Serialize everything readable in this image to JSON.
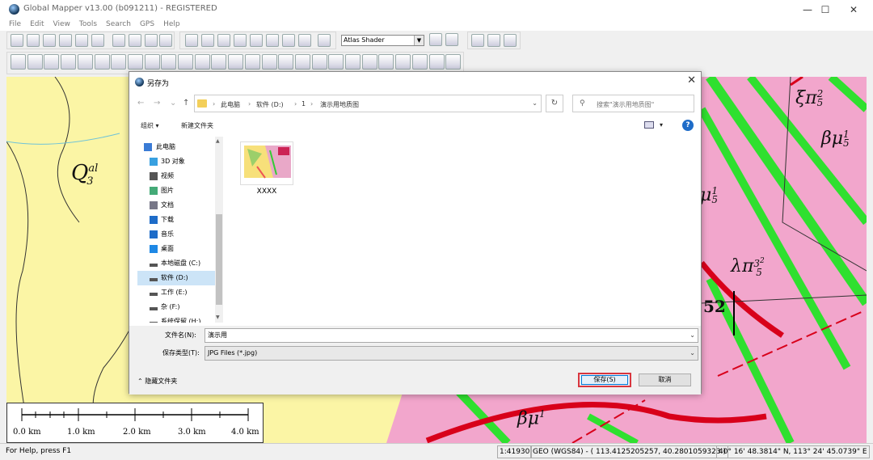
{
  "app": {
    "title": "Global Mapper v13.00 (b091211) - REGISTERED",
    "window_controls": {
      "minimize": "—",
      "maximize": "☐",
      "close": "✕"
    }
  },
  "menu": [
    "File",
    "Edit",
    "View",
    "Tools",
    "Search",
    "GPS",
    "Help"
  ],
  "toolbar": {
    "shader_select": "Atlas Shader"
  },
  "map": {
    "labels": {
      "q3_base": "Q",
      "q3_sup": "al",
      "q3_sub": "3",
      "xi_pi": "ξπ",
      "xi_pi_sup": "2",
      "xi_pi_sub": "5",
      "beta_mu": "βμ",
      "beta_mu_sup": "1",
      "beta_mu_sub": "5",
      "mu_right": "μ",
      "mu_right_sup": "1",
      "mu_right_sub": "5",
      "lambda_pi": "λπ",
      "lambda_pi_sup": "3",
      "lambda_pi_sup2": "2",
      "lambda_pi_sub": "5",
      "number_52": "52",
      "beta_mu_bottom": "βμ",
      "beta_mu_bottom_sup": "1"
    },
    "scale_bar": [
      "0.0 km",
      "1.0 km",
      "2.0 km",
      "3.0 km",
      "4.0 km"
    ]
  },
  "status_bar": {
    "help": "For Help, press F1",
    "scale": "1:41930",
    "coords": "GEO (WGS84) - ( 113.4125205257, 40.2801059323 )",
    "dms": "40° 16' 48.3814\" N, 113° 24' 45.0739\" E"
  },
  "dialog": {
    "title": "另存为",
    "close": "✕",
    "breadcrumb": [
      "此电脑",
      "软件 (D:)",
      "1",
      "演示用地质图"
    ],
    "search_placeholder": "搜索\"演示用地质图\"",
    "organize": "组织 ▾",
    "new_folder": "新建文件夹",
    "help": "?",
    "nav_items": [
      {
        "label": "此电脑",
        "icon": "computer-icon"
      },
      {
        "label": "3D 对象",
        "icon": "cube-icon"
      },
      {
        "label": "视频",
        "icon": "video-icon"
      },
      {
        "label": "图片",
        "icon": "picture-icon"
      },
      {
        "label": "文档",
        "icon": "document-icon"
      },
      {
        "label": "下载",
        "icon": "download-icon"
      },
      {
        "label": "音乐",
        "icon": "music-icon"
      },
      {
        "label": "桌面",
        "icon": "desktop-icon"
      },
      {
        "label": "本地磁盘 (C:)",
        "icon": "drive-icon"
      },
      {
        "label": "软件 (D:)",
        "icon": "drive-icon"
      },
      {
        "label": "工作 (E:)",
        "icon": "drive-icon"
      },
      {
        "label": "杂 (F:)",
        "icon": "drive-icon"
      },
      {
        "label": "系统保留 (H:)",
        "icon": "drive-icon"
      }
    ],
    "files": [
      {
        "name": "XXXX"
      }
    ],
    "filename_label": "文件名(N):",
    "filename_value": "演示用",
    "filetype_label": "保存类型(T):",
    "filetype_value": "JPG Files (*.jpg)",
    "hide_folders": "隐藏文件夹",
    "save": "保存(S)",
    "cancel": "取消"
  },
  "colors": {
    "map_yellow": "#fbf5a5",
    "map_pink": "#f2a6cc",
    "dyke_green": "#2fe02f",
    "fault_red": "#d8001a",
    "save_highlight": "#d9363e"
  }
}
